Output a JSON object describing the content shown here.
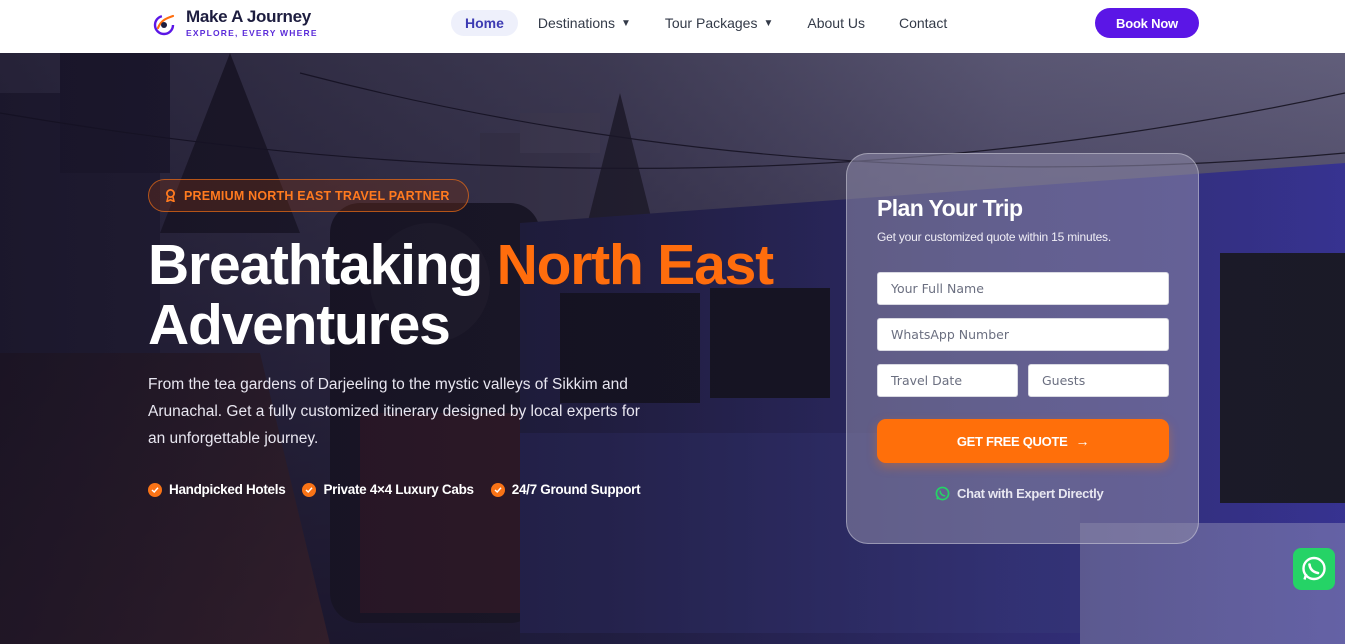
{
  "brand": {
    "name": "Make A Journey",
    "tagline": "EXPLORE, EVERY WHERE",
    "accent": "#5b16e6",
    "orange": "#ff6d0d"
  },
  "nav": {
    "items": [
      {
        "label": "Home",
        "active": true,
        "dropdown": false
      },
      {
        "label": "Destinations",
        "active": false,
        "dropdown": true
      },
      {
        "label": "Tour Packages",
        "active": false,
        "dropdown": true
      },
      {
        "label": "About Us",
        "active": false,
        "dropdown": false
      },
      {
        "label": "Contact",
        "active": false,
        "dropdown": false
      }
    ],
    "caret": "▼",
    "cta": "Book Now"
  },
  "hero": {
    "badge": "PREMIUM NORTH EAST TRAVEL PARTNER",
    "headline_part1": "Breathtaking",
    "headline_accent": "North East",
    "headline_part2": "Adventures",
    "lead": "From the tea gardens of Darjeeling to the mystic valleys of Sikkim and Arunachal. Get a fully customized itinerary designed by local experts for an unforgettable journey.",
    "features": [
      "Handpicked Hotels",
      "Private 4×4 Luxury Cabs",
      "24/7 Ground Support"
    ]
  },
  "form": {
    "title": "Plan Your Trip",
    "subtitle": "Get your customized quote within 15 minutes.",
    "name_placeholder": "Your Full Name",
    "whatsapp_placeholder": "WhatsApp Number",
    "date_placeholder": "Travel Date",
    "guests_placeholder": "Guests",
    "submit": "GET FREE QUOTE",
    "chat": "Chat with Expert Directly"
  },
  "icons": {
    "badge": "award-icon",
    "feature": "check-circle-icon",
    "arrow": "arrow-right-icon",
    "whatsapp": "whatsapp-icon"
  }
}
